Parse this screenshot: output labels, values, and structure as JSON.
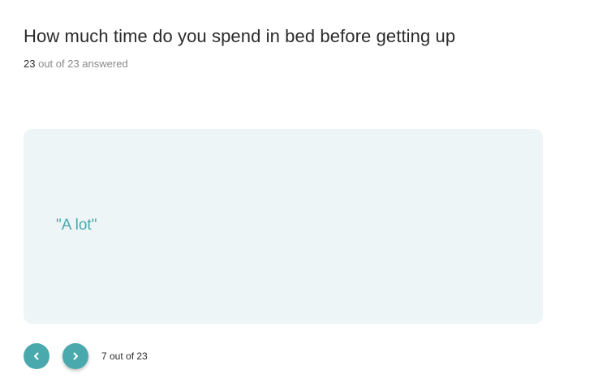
{
  "question": {
    "title": "How much time do you spend in bed before getting up",
    "answered_count": "23",
    "answered_suffix": "out of 23 answered"
  },
  "response": {
    "text": "\"A lot\""
  },
  "pager": {
    "prev_icon": "chevron-left-icon",
    "next_icon": "chevron-right-icon",
    "position_text": "7 out of 23"
  },
  "colors": {
    "accent": "#4aa9ad",
    "card_background": "#edf5f6",
    "text": "#2b2b2b",
    "muted_text": "#8a8a8a"
  }
}
